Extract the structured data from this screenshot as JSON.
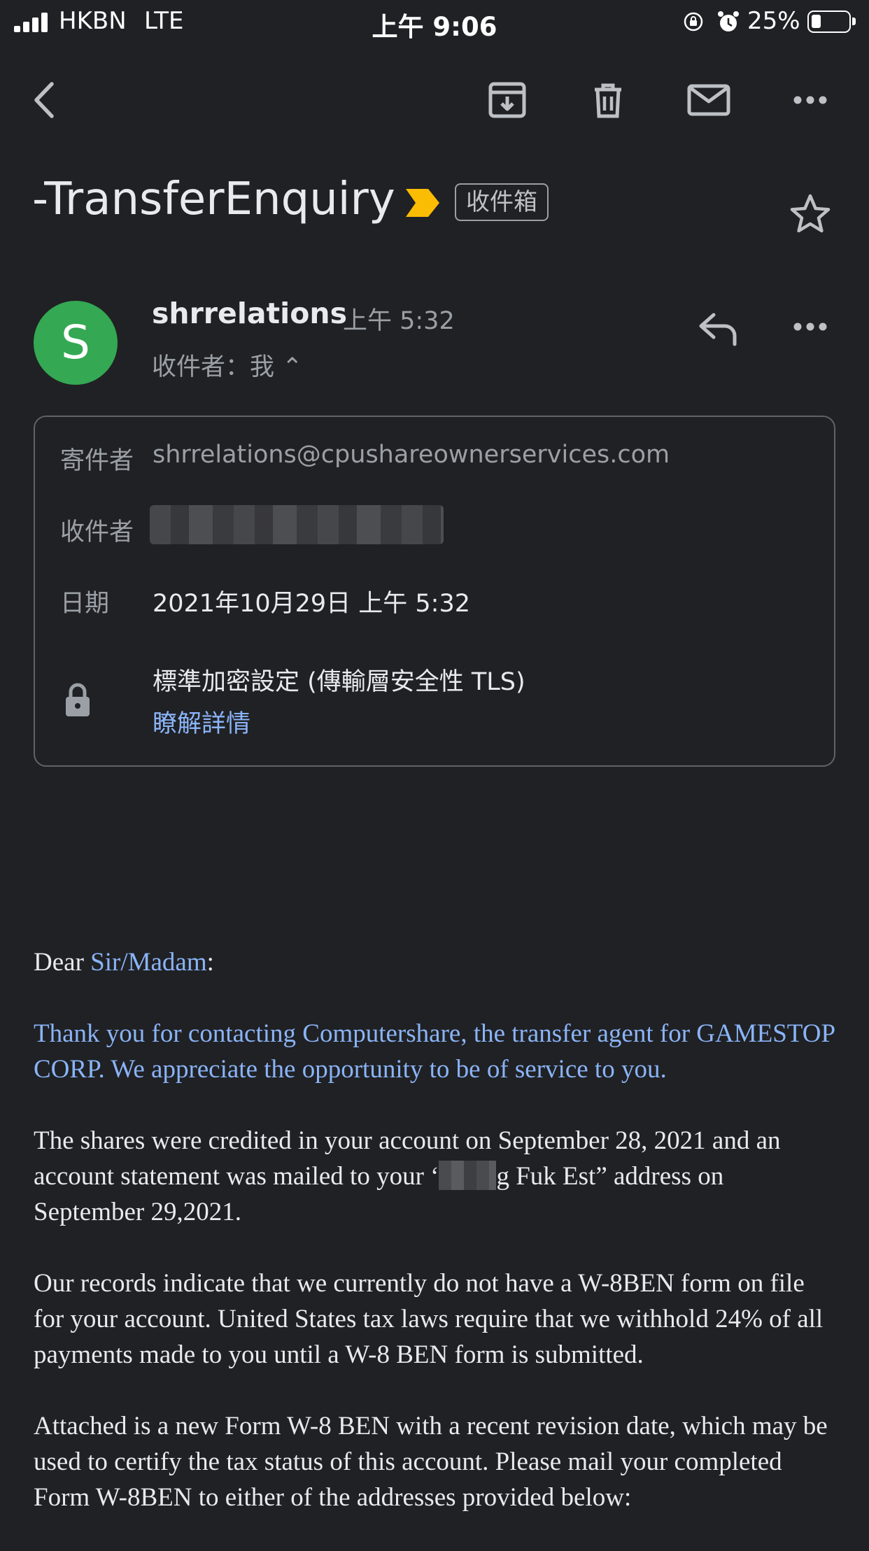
{
  "status_bar": {
    "carrier": "HKBN",
    "network": "LTE",
    "time": "上午 9:06",
    "battery_percent": "25%",
    "battery_level": 0.25
  },
  "toolbar": {
    "icons": [
      "back-arrow-icon",
      "archive-icon",
      "trash-icon",
      "mark-unread-icon",
      "more-vert-icon"
    ]
  },
  "message": {
    "subject": "-TransferEnquiry",
    "importance_marker_color": "#fbbc04",
    "label": "收件箱",
    "sender_name": "shrrelations",
    "sender_initial": "S",
    "avatar_color": "#34a853",
    "time": "上午 5:32",
    "recipients_summary": "收件者：我 ⌃"
  },
  "details": {
    "from_label": "寄件者",
    "from_value": "shrrelations@cpushareownerservices.com",
    "to_label": "收件者",
    "date_label": "日期",
    "date_value": "2021年10月29日 上午 5:32",
    "encryption_text": "標準加密設定 (傳輸層安全性 TLS)",
    "learn_more": "瞭解詳情"
  },
  "body": {
    "greeting_prefix": "Dear ",
    "greeting_name": "Sir/Madam",
    "greeting_suffix": ":",
    "para1": "Thank you for contacting Computershare, the transfer agent for GAMESTOP CORP. We appreciate the opportunity to be of service to you.",
    "para2_before": "The shares were credited in your account on September 28, 2021 and an account statement was mailed to your ‘",
    "para2_after": "g Fuk Est” address on September 29,2021.",
    "para3": "Our records indicate that we currently do not have a W-8BEN form on file for your account. United States tax laws require that we withhold 24% of all payments made to you until a W-8 BEN form is submitted.",
    "para4": "Attached is a new Form W-8 BEN with a recent revision date, which may be used to certify the tax status of this account. Please mail your completed Form W-8BEN to either of the addresses provided below:"
  }
}
